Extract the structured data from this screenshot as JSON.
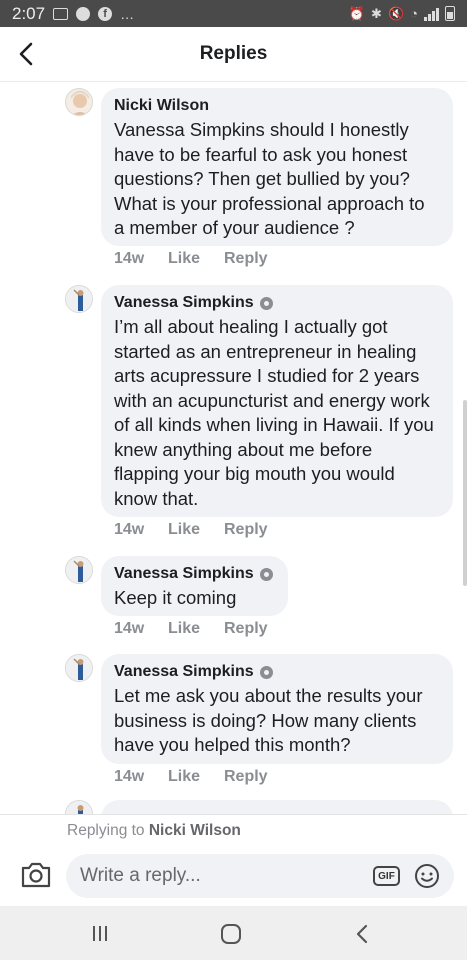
{
  "status_bar": {
    "time": "2:07",
    "dots": "…"
  },
  "header": {
    "title": "Replies"
  },
  "comments": [
    {
      "author": "Nicki Wilson",
      "text": "Vanessa Simpkins should I honestly have to be fearful to ask you honest questions? Then get bullied by you? What is your professional approach to a member of your audience ?",
      "time": "14w",
      "like": "Like",
      "reply": "Reply"
    },
    {
      "author": "Vanessa Simpkins",
      "text": "I’m all about healing I actually got started as an entrepreneur in healing arts acupressure I studied for 2 years with an acupuncturist and energy work of all kinds when living in Hawaii. If you knew anything about me before flapping your big mouth you would know that.",
      "time": "14w",
      "like": "Like",
      "reply": "Reply"
    },
    {
      "author": "Vanessa Simpkins",
      "text": "Keep it coming",
      "time": "14w",
      "like": "Like",
      "reply": "Reply"
    },
    {
      "author": "Vanessa Simpkins",
      "text": "Let me ask you about the results your business is doing? How many clients have you helped this month?",
      "time": "14w",
      "like": "Like",
      "reply": "Reply"
    }
  ],
  "composer": {
    "replying_prefix": "Replying to",
    "replying_to": "Nicki Wilson",
    "placeholder": "Write a reply...",
    "gif": "GIF"
  }
}
